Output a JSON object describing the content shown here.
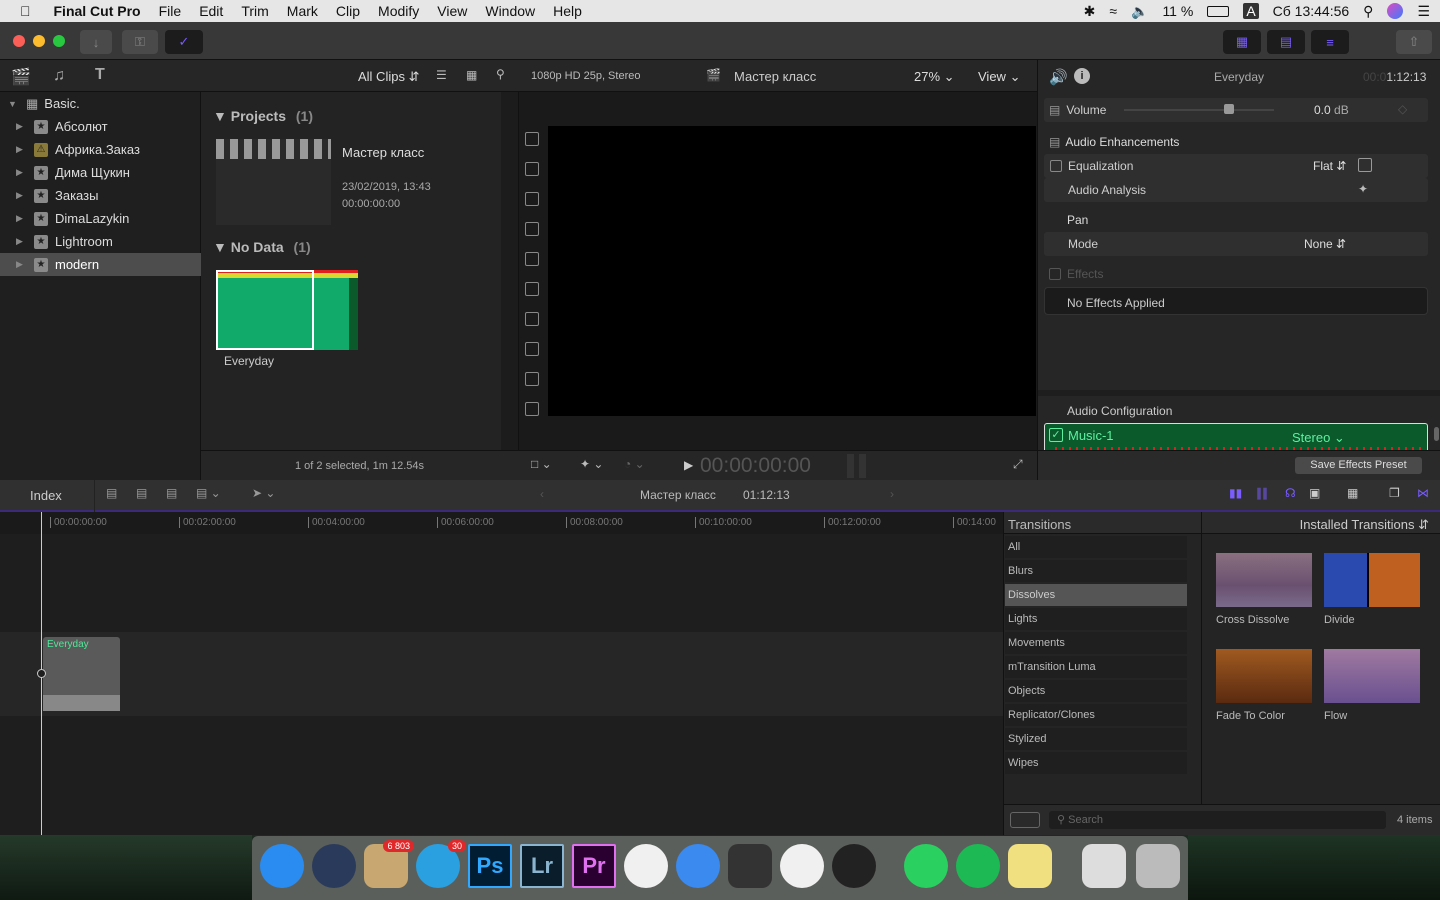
{
  "menubar": {
    "app": "Final Cut Pro",
    "items": [
      "File",
      "Edit",
      "Trim",
      "Mark",
      "Clip",
      "Modify",
      "View",
      "Window",
      "Help"
    ],
    "battery": "11 %",
    "input": "A",
    "clock": "Сб 13:44:56"
  },
  "library": {
    "filter": "All Clips",
    "items": [
      {
        "label": "Basic.",
        "expanded": true
      },
      {
        "label": "Абсолют"
      },
      {
        "label": "Африка.Заказ",
        "warning": true
      },
      {
        "label": "Дима Щукин"
      },
      {
        "label": "Заказы"
      },
      {
        "label": "DimaLazykin"
      },
      {
        "label": "Lightroom"
      },
      {
        "label": "modern",
        "selected": true
      }
    ]
  },
  "browser": {
    "projects_header": "Projects",
    "projects_count": "(1)",
    "project": {
      "name": "Мастер класс",
      "date": "23/02/2019, 13:43",
      "duration": "00:00:00:00"
    },
    "nodata_header": "No Data",
    "nodata_count": "(1)",
    "clip": "Everyday",
    "footer": "1 of 2 selected, 1m 12.54s"
  },
  "viewer": {
    "format": "1080p HD 25p, Stereo",
    "title": "Мастер класс",
    "zoom": "27%",
    "view": "View",
    "timecode": "00:00:00:00"
  },
  "inspector": {
    "clip": "Everyday",
    "timecode_dim": "00:0",
    "timecode": "1:12:13",
    "volume_label": "Volume",
    "volume_value": "0.0",
    "volume_unit": "dB",
    "volume_level": 0.7,
    "enh": "Audio Enhancements",
    "eq": "Equalization",
    "eq_value": "Flat",
    "analysis": "Audio Analysis",
    "pan": "Pan",
    "mode": "Mode",
    "mode_value": "None",
    "effects": "Effects",
    "no_effects": "No Effects Applied",
    "config": "Audio Configuration",
    "channel": "Music-1",
    "channel_mode": "Stereo",
    "save_preset": "Save Effects Preset"
  },
  "timeline": {
    "index": "Index",
    "project": "Мастер класс",
    "duration": "01:12:13",
    "ruler": [
      "00:00:00:00",
      "00:02:00:00",
      "00:04:00:00",
      "00:06:00:00",
      "00:08:00:00",
      "00:10:00:00",
      "00:12:00:00",
      "00:14:00"
    ],
    "clip": "Everyday"
  },
  "transitions": {
    "title": "Transitions",
    "source": "Installed Transitions",
    "categories": [
      "All",
      "Blurs",
      "Dissolves",
      "Lights",
      "Movements",
      "mTransition Luma",
      "Objects",
      "Replicator/Clones",
      "Stylized",
      "Wipes"
    ],
    "selected": "Dissolves",
    "items": [
      "Cross Dissolve",
      "Divide",
      "Fade To Color",
      "Flow"
    ],
    "search_placeholder": "Search",
    "count": "4 items"
  },
  "dock": {
    "apps": [
      {
        "name": "Finder"
      },
      {
        "name": "QuickTime"
      },
      {
        "name": "Mail",
        "badge": "6 803"
      },
      {
        "name": "Telegram",
        "badge": "30"
      },
      {
        "name": "Ps"
      },
      {
        "name": "Lr"
      },
      {
        "name": "Pr"
      },
      {
        "name": "Photos"
      },
      {
        "name": "Safari"
      },
      {
        "name": "Final Cut Pro"
      },
      {
        "name": "iTunes"
      },
      {
        "name": "DaVinci Resolve"
      },
      {
        "name": "WhatsApp"
      },
      {
        "name": "Spotify"
      },
      {
        "name": "Notes"
      },
      {
        "name": "Preview"
      },
      {
        "name": "Trash"
      }
    ]
  },
  "colors": {
    "accent": "#7a5cff",
    "audio_green": "#0a5a2c",
    "clip_green": "#1aa86a"
  }
}
